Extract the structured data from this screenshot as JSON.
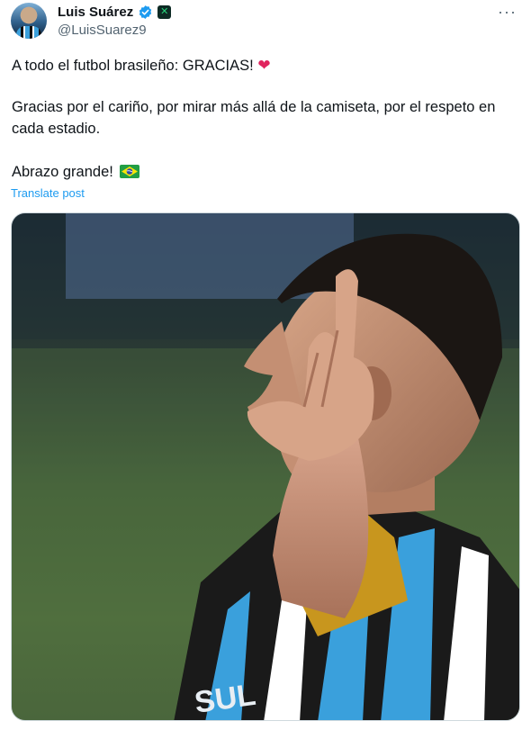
{
  "author": {
    "display_name": "Luis Suárez",
    "handle": "@LuisSuarez9"
  },
  "icons": {
    "verified": "verified-badge-icon",
    "affiliation": "affiliation-badge-icon",
    "more": "more-options-icon",
    "heart": "red-heart-emoji",
    "flag": "brazil-flag-emoji"
  },
  "post": {
    "line1": "A todo el futbol brasileño: GRACIAS!",
    "line2": "Gracias por el cariño, por mirar más allá de la camiseta, por el respeto en cada estadio.",
    "line3": "Abrazo grande!"
  },
  "translate_label": "Translate post",
  "media_lettering": "SUL",
  "colors": {
    "link": "#1d9bf0",
    "verified": "#1d9bf0",
    "heart": "#e0245e",
    "text": "#0f1419",
    "secondary": "#536471"
  }
}
